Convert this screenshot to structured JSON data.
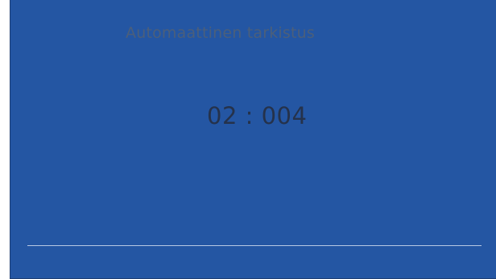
{
  "screen": {
    "title": "Automaattinen tarkistus",
    "timer": "02 : 004",
    "background_color": "#2456a3"
  }
}
